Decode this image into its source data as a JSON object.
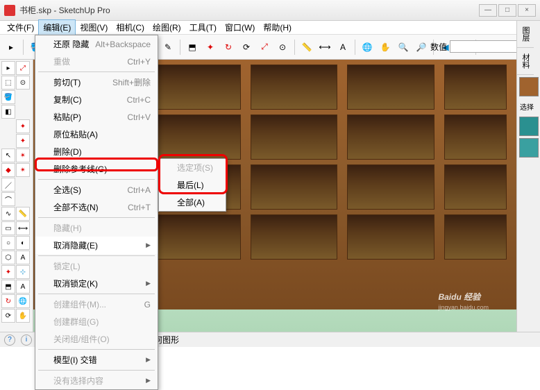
{
  "window": {
    "title": "书柜.skp - SketchUp Pro",
    "buttons": {
      "min": "—",
      "max": "□",
      "close": "×"
    }
  },
  "menubar": {
    "items": [
      "文件(F)",
      "编辑(E)",
      "视图(V)",
      "相机(C)",
      "绘图(R)",
      "工具(T)",
      "窗口(W)",
      "帮助(H)"
    ],
    "active_index": 1
  },
  "toolbar": {
    "measure_label": "数值",
    "measure_value": ""
  },
  "dropdown": {
    "items": [
      {
        "label": "还原 隐藏",
        "shortcut": "Alt+Backspace",
        "disabled": false
      },
      {
        "label": "重做",
        "shortcut": "Ctrl+Y",
        "disabled": true
      },
      {
        "sep": true
      },
      {
        "label": "剪切(T)",
        "shortcut": "Shift+删除"
      },
      {
        "label": "复制(C)",
        "shortcut": "Ctrl+C"
      },
      {
        "label": "粘贴(P)",
        "shortcut": "Ctrl+V"
      },
      {
        "label": "原位粘贴(A)"
      },
      {
        "label": "删除(D)"
      },
      {
        "label": "删除参考线(G)"
      },
      {
        "sep": true
      },
      {
        "label": "全选(S)",
        "shortcut": "Ctrl+A"
      },
      {
        "label": "全部不选(N)",
        "shortcut": "Ctrl+T"
      },
      {
        "sep": true
      },
      {
        "label": "隐藏(H)",
        "disabled": true
      },
      {
        "label": "取消隐藏(E)",
        "submenu": true,
        "hl": true
      },
      {
        "sep": true
      },
      {
        "label": "锁定(L)",
        "disabled": true
      },
      {
        "label": "取消锁定(K)",
        "submenu": true
      },
      {
        "sep": true
      },
      {
        "label": "创建组件(M)...",
        "shortcut": "G",
        "disabled": true
      },
      {
        "label": "创建群组(G)",
        "disabled": true
      },
      {
        "label": "关闭组/组件(O)",
        "disabled": true
      },
      {
        "sep": true
      },
      {
        "label": "模型(I) 交错",
        "submenu": true
      },
      {
        "sep": true
      },
      {
        "label": "没有选择内容",
        "disabled": true,
        "submenu": true
      }
    ]
  },
  "submenu": {
    "items": [
      {
        "label": "选定项(S)",
        "disabled": true
      },
      {
        "label": "最后(L)"
      },
      {
        "label": "全部(A)"
      }
    ]
  },
  "rightpanel": {
    "tabs": [
      "图层",
      "材料"
    ],
    "select_label": "选择"
  },
  "statusbar": {
    "hint": "取消隐藏最后一个隐藏的几何图形"
  },
  "watermark": {
    "brand": "Baidu 经验",
    "url": "jingyan.baidu.com"
  }
}
